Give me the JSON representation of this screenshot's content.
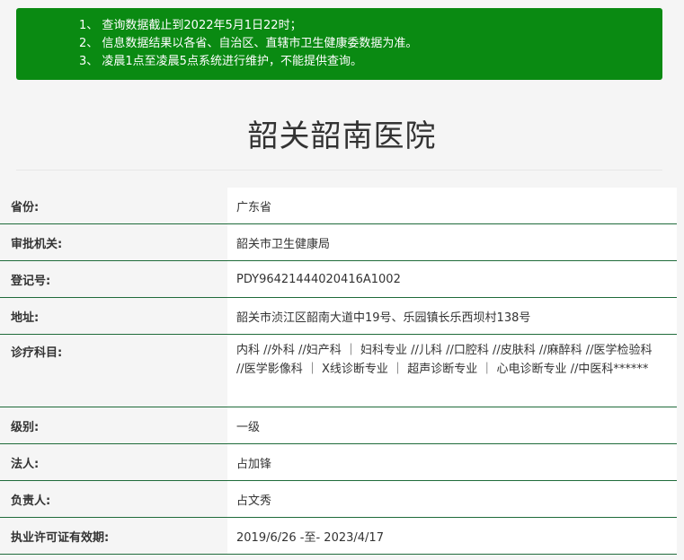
{
  "notice": {
    "lines": [
      "1、 查询数据截止到2022年5月1日22时；",
      "2、 信息数据结果以各省、自治区、直辖市卫生健康委数据为准。",
      "3、 凌晨1点至凌晨5点系统进行维护，不能提供查询。"
    ]
  },
  "title": "韶关韶南医院",
  "rows": [
    {
      "label": "省份:",
      "value": "广东省"
    },
    {
      "label": "审批机关:",
      "value": "韶关市卫生健康局"
    },
    {
      "label": "登记号:",
      "value": "PDY96421444020416A1002"
    },
    {
      "label": "地址:",
      "value": "韶关市浈江区韶南大道中19号、乐园镇长乐西坝村138号"
    },
    {
      "label": "诊疗科目:",
      "value": "内科 //外科 //妇产科 ｜ 妇科专业 //儿科 //口腔科 //皮肤科 //麻醉科 //医学检验科 //医学影像科 ｜ X线诊断专业 ｜ 超声诊断专业 ｜ 心电诊断专业 //中医科******"
    },
    {
      "label": "级别:",
      "value": "一级"
    },
    {
      "label": "法人:",
      "value": "占加锋"
    },
    {
      "label": "负责人:",
      "value": "占文秀"
    },
    {
      "label": "执业许可证有效期:",
      "value": "2019/6/26 -至- 2023/4/17"
    }
  ]
}
